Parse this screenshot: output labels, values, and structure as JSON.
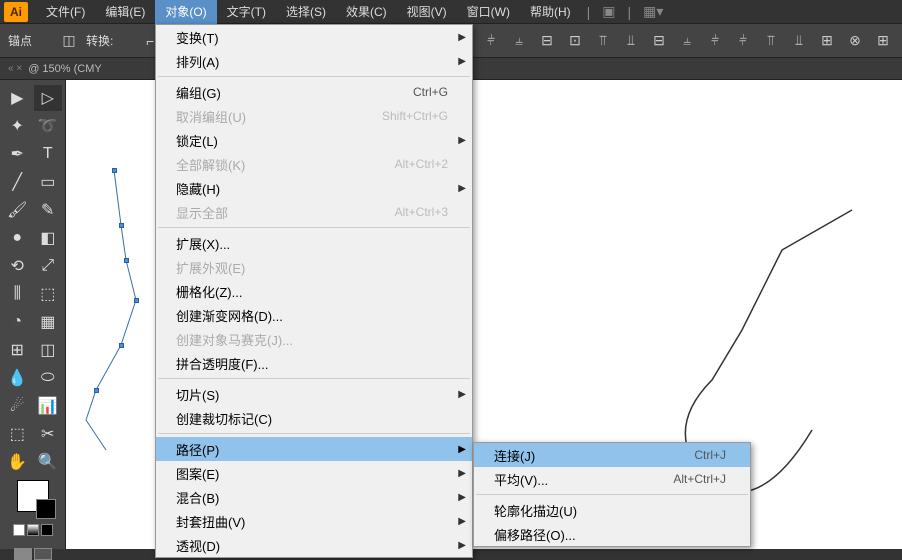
{
  "menubar": {
    "items": [
      "文件(F)",
      "编辑(E)",
      "对象(O)",
      "文字(T)",
      "选择(S)",
      "效果(C)",
      "视图(V)",
      "窗口(W)",
      "帮助(H)"
    ],
    "active_index": 2
  },
  "controlbar": {
    "anchor_label": "锚点",
    "convert_label": "转换:"
  },
  "doctab": {
    "label": "@ 150% (CMY"
  },
  "menu": [
    {
      "label": "变换(T)",
      "sub": true
    },
    {
      "label": "排列(A)",
      "sub": true
    },
    {
      "sep": true
    },
    {
      "label": "编组(G)",
      "shortcut": "Ctrl+G"
    },
    {
      "label": "取消编组(U)",
      "shortcut": "Shift+Ctrl+G",
      "disabled": true
    },
    {
      "label": "锁定(L)",
      "sub": true
    },
    {
      "label": "全部解锁(K)",
      "shortcut": "Alt+Ctrl+2",
      "disabled": true
    },
    {
      "label": "隐藏(H)",
      "sub": true
    },
    {
      "label": "显示全部",
      "shortcut": "Alt+Ctrl+3",
      "disabled": true
    },
    {
      "sep": true
    },
    {
      "label": "扩展(X)..."
    },
    {
      "label": "扩展外观(E)",
      "disabled": true
    },
    {
      "label": "栅格化(Z)..."
    },
    {
      "label": "创建渐变网格(D)..."
    },
    {
      "label": "创建对象马赛克(J)...",
      "disabled": true
    },
    {
      "label": "拼合透明度(F)..."
    },
    {
      "sep": true
    },
    {
      "label": "切片(S)",
      "sub": true
    },
    {
      "label": "创建裁切标记(C)"
    },
    {
      "sep": true
    },
    {
      "label": "路径(P)",
      "sub": true,
      "highlight": true
    },
    {
      "label": "图案(E)",
      "sub": true
    },
    {
      "label": "混合(B)",
      "sub": true
    },
    {
      "label": "封套扭曲(V)",
      "sub": true
    },
    {
      "label": "透视(D)",
      "sub": true
    }
  ],
  "submenu": [
    {
      "label": "连接(J)",
      "shortcut": "Ctrl+J",
      "highlight": true
    },
    {
      "label": "平均(V)...",
      "shortcut": "Alt+Ctrl+J"
    },
    {
      "sep": true
    },
    {
      "label": "轮廓化描边(U)"
    },
    {
      "label": "偏移路径(O)..."
    }
  ]
}
